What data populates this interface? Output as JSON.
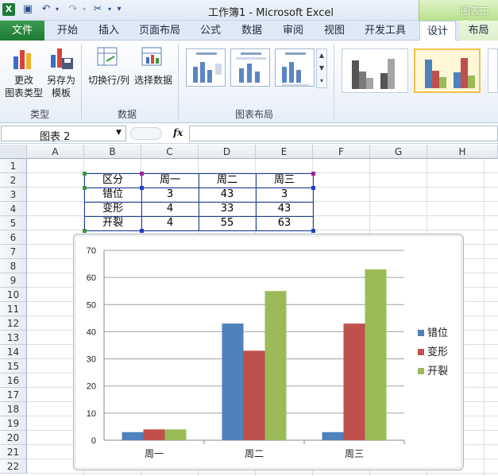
{
  "window": {
    "title": "工作簿1 - Microsoft Excel",
    "context_tab_group": "图表工具"
  },
  "ribbon_tabs": [
    {
      "label": "文件"
    },
    {
      "label": "开始"
    },
    {
      "label": "插入"
    },
    {
      "label": "页面布局"
    },
    {
      "label": "公式"
    },
    {
      "label": "数据"
    },
    {
      "label": "审阅"
    },
    {
      "label": "视图"
    },
    {
      "label": "开发工具"
    },
    {
      "label": "设计"
    },
    {
      "label": "布局"
    }
  ],
  "ribbon": {
    "change_type_line1": "更改",
    "change_type_line2": "图表类型",
    "save_template_line1": "另存为",
    "save_template_line2": "模板",
    "switch_row_col": "切换行/列",
    "select_data": "选择数据",
    "group_type": "类型",
    "group_data": "数据",
    "group_layout": "图表布局"
  },
  "formula_bar": {
    "name_box": "图表 2",
    "fx": "fx",
    "formula": ""
  },
  "columns": [
    "A",
    "B",
    "C",
    "D",
    "E",
    "F",
    "G",
    "H"
  ],
  "rows": [
    "1",
    "2",
    "3",
    "4",
    "5",
    "6",
    "7",
    "8",
    "9",
    "10",
    "11",
    "12",
    "13",
    "14",
    "15",
    "16",
    "17",
    "18",
    "19",
    "20",
    "21",
    "22"
  ],
  "table": {
    "header": [
      "区分",
      "周一",
      "周二",
      "周三"
    ],
    "rows": [
      [
        "错位",
        "3",
        "43",
        "3"
      ],
      [
        "变形",
        "4",
        "33",
        "43"
      ],
      [
        "开裂",
        "4",
        "55",
        "63"
      ]
    ]
  },
  "chart_data": {
    "type": "bar",
    "categories": [
      "周一",
      "周二",
      "周三"
    ],
    "series": [
      {
        "name": "错位",
        "values": [
          3,
          43,
          3
        ],
        "color": "#4f81bd"
      },
      {
        "name": "变形",
        "values": [
          4,
          33,
          43
        ],
        "color": "#c0504d"
      },
      {
        "name": "开裂",
        "values": [
          4,
          55,
          63
        ],
        "color": "#9bbb59"
      }
    ],
    "ylim": [
      0,
      70
    ],
    "yticks": [
      0,
      10,
      20,
      30,
      40,
      50,
      60,
      70
    ],
    "grid": true,
    "legend": "right"
  },
  "colors": {
    "file_tab": "#1f7a34",
    "selection": "#1f3f9a",
    "selected_style": "#f0c24a"
  }
}
